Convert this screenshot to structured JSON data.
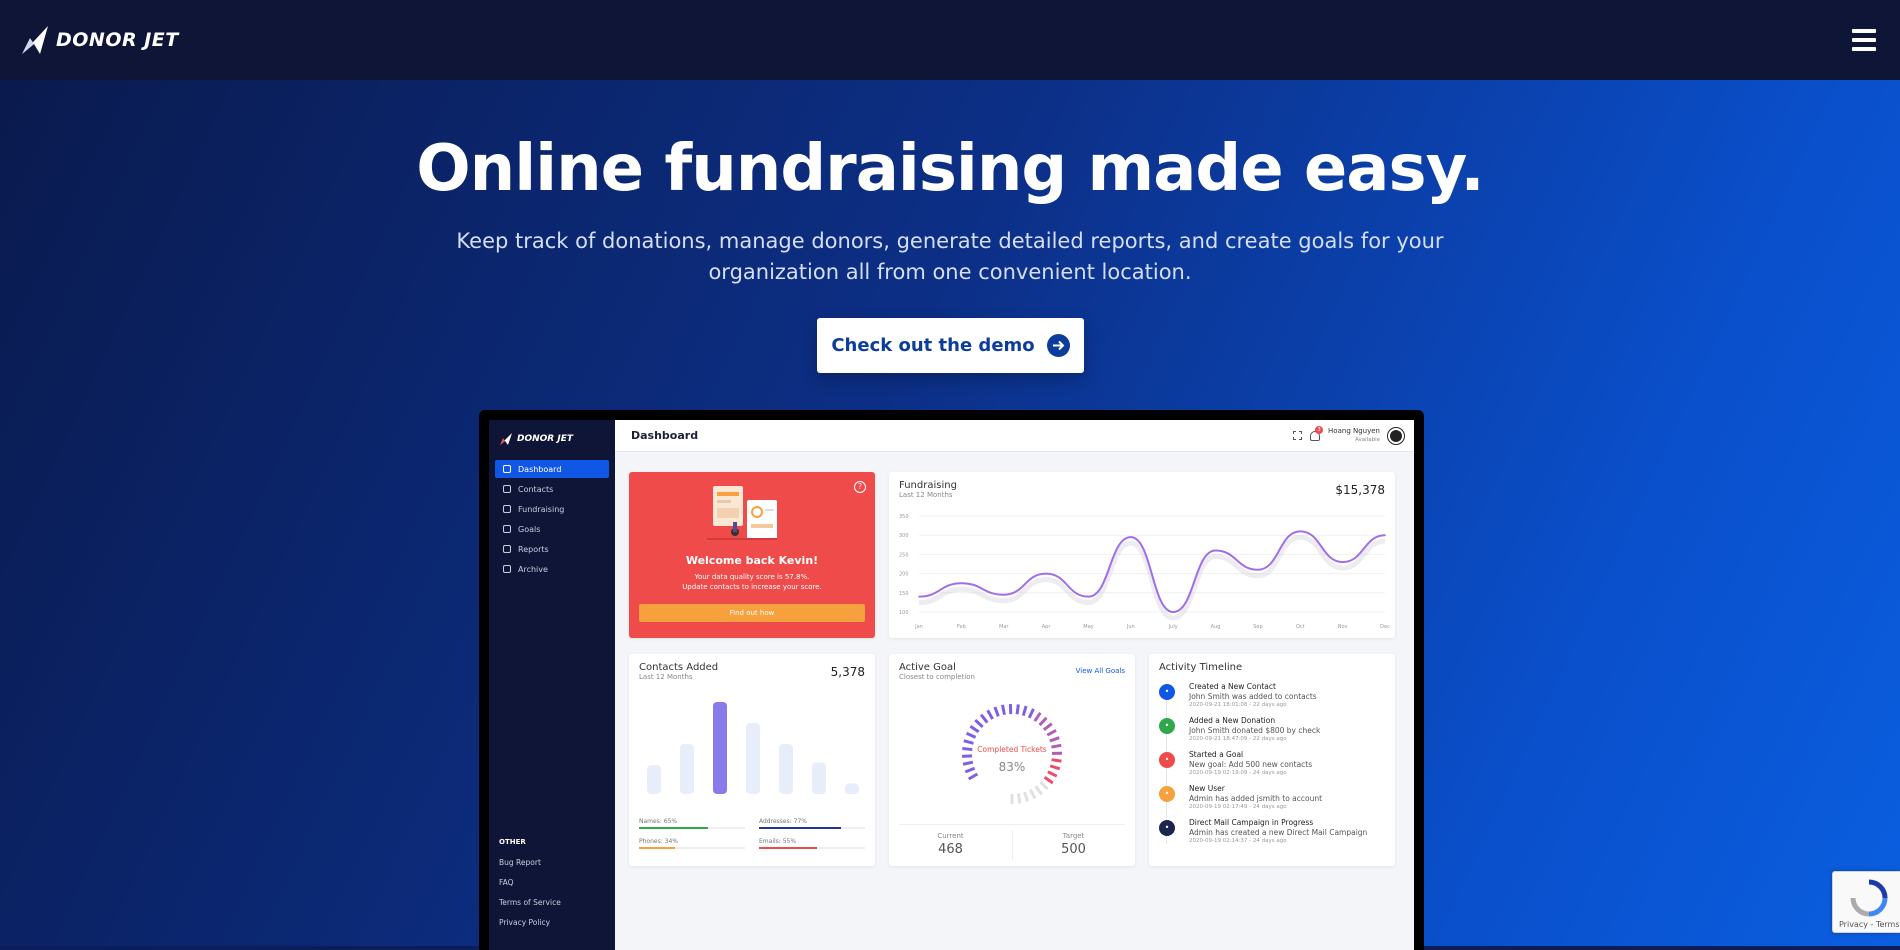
{
  "nav": {
    "brand": "DONOR JET",
    "menu_icon": "hamburger-menu-icon"
  },
  "hero": {
    "title": "Online fundraising made easy.",
    "subtitle": "Keep track of donations, manage donors, generate detailed reports, and create goals for your organization all from one convenient location.",
    "cta_label": "Check out the demo",
    "cta_icon": "arrow-circle-right-icon"
  },
  "dashboard": {
    "brand": "DONOR JET",
    "page_title": "Dashboard",
    "notifications_count": "3",
    "user_name": "Hoang Nguyen",
    "user_status": "Available",
    "sidebar": {
      "items": [
        {
          "label": "Dashboard",
          "icon": "dashboard-icon",
          "active": true
        },
        {
          "label": "Contacts",
          "icon": "contacts-icon"
        },
        {
          "label": "Fundraising",
          "icon": "fundraising-icon"
        },
        {
          "label": "Goals",
          "icon": "goals-icon"
        },
        {
          "label": "Reports",
          "icon": "reports-icon"
        },
        {
          "label": "Archive",
          "icon": "archive-icon"
        }
      ],
      "other_heading": "OTHER",
      "other_links": [
        "Bug Report",
        "FAQ",
        "Terms of Service",
        "Privacy Policy"
      ]
    },
    "welcome": {
      "title": "Welcome back Kevin!",
      "line1": "Your data quality score is 57.8%.",
      "line2": "Update contacts to increase your score.",
      "button": "Find out how"
    },
    "fundraising": {
      "title": "Fundraising",
      "subtitle": "Last 12 Months",
      "value": "$15,378"
    },
    "contacts_added": {
      "title": "Contacts Added",
      "subtitle": "Last 12 Months",
      "value": "5,378",
      "stats": [
        {
          "label": "Names: 65%",
          "pct": 0.65,
          "color": "#2ea84a"
        },
        {
          "label": "Addresses: 77%",
          "pct": 0.77,
          "color": "#1e3a8a"
        },
        {
          "label": "Phones: 34%",
          "pct": 0.34,
          "color": "#f6a03e"
        },
        {
          "label": "Emails: 55%",
          "pct": 0.55,
          "color": "#ef4b4b"
        }
      ]
    },
    "active_goal": {
      "title": "Active Goal",
      "subtitle": "Closest to completion",
      "link": "View All Goals",
      "gauge_label": "Completed Tickets",
      "gauge_value": "83%",
      "gauge_fraction": 0.83,
      "current_label": "Current",
      "current_value": "468",
      "target_label": "Target",
      "target_value": "500"
    },
    "timeline": {
      "title": "Activity Timeline",
      "items": [
        {
          "head": "Created a New Contact",
          "body": "John Smith was added to contacts",
          "time": "2020-09-21 18:01:08 - 22 days ago",
          "color": "#1157e6"
        },
        {
          "head": "Added a New Donation",
          "body": "John Smith donated $800 by check",
          "time": "2020-09-21 18:47:09 - 22 days ago",
          "color": "#2ea84a"
        },
        {
          "head": "Started a Goal",
          "body": "New goal: Add 500 new contacts",
          "time": "2020-09-19 02:19:09 - 24 days ago",
          "color": "#ef4b4b"
        },
        {
          "head": "New User",
          "body": "Admin has added jsmith to account",
          "time": "2020-09-19 02:17:49 - 24 days ago",
          "color": "#f6a03e"
        },
        {
          "head": "Direct Mail Campaign in Progress",
          "body": "Admin has created a new Direct Mail Campaign",
          "time": "2020-09-19 02:14:37 - 24 days ago",
          "color": "#1a2550"
        }
      ]
    }
  },
  "chart_data": [
    {
      "type": "line",
      "title": "Fundraising",
      "subtitle": "Last 12 Months",
      "categories": [
        "Jan",
        "Feb",
        "Mar",
        "Apr",
        "May",
        "Jun",
        "July",
        "Aug",
        "Sep",
        "Oct",
        "Nov",
        "Dec"
      ],
      "yticks": [
        "350",
        "300",
        "250",
        "200",
        "150",
        "100"
      ],
      "ylim": [
        100,
        350
      ],
      "values": [
        140,
        175,
        145,
        200,
        140,
        295,
        100,
        260,
        210,
        310,
        230,
        300
      ],
      "color": "#a06ee8"
    },
    {
      "type": "bar",
      "title": "Contacts Added",
      "values": [
        22,
        38,
        70,
        54,
        38,
        24,
        8
      ],
      "highlight_index": 2,
      "color": "#e8eef9",
      "highlight_color": "#8a7bea"
    }
  ]
}
